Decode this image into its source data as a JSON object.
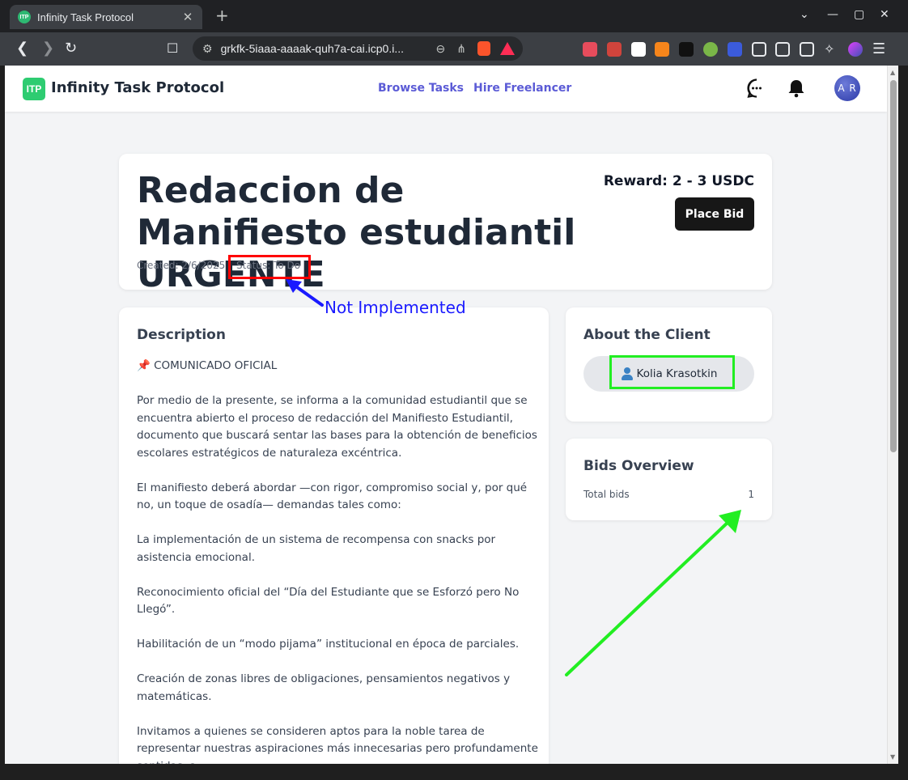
{
  "browser": {
    "tab_title": "Infinity Task Protocol",
    "tab_favicon_text": "ITP",
    "new_tab": "+",
    "url": "grkfk-5iaaa-aaaak-quh7a-cai.icp0.i...",
    "window_controls": [
      "⌄",
      "—",
      "▢",
      "✕"
    ]
  },
  "header": {
    "logo_badge": "ITP",
    "logo_text": "Infinity Task Protocol",
    "nav": [
      "Browse Tasks",
      "Hire Freelancer"
    ],
    "avatar_initials": "A R"
  },
  "task": {
    "title": "Redaccion de Manifiesto estudiantil URGENTE",
    "created": "Created: 2/6/2025",
    "separator": "·",
    "status": "Status: To Do",
    "reward": "Reward: 2 - 3 USDC",
    "bid_button": "Place Bid"
  },
  "description": {
    "heading": "Description",
    "paragraphs": [
      "📌 COMUNICADO OFICIAL",
      "Por medio de la presente, se informa a la comunidad estudiantil que se encuentra abierto el proceso de redacción del Manifiesto Estudiantil, documento que buscará sentar las bases para la obtención de beneficios escolares estratégicos de naturaleza excéntrica.",
      "El manifiesto deberá abordar —con rigor, compromiso social y, por qué no, un toque de osadía— demandas tales como:",
      "La implementación de un sistema de recompensa con snacks por asistencia emocional.",
      "Reconocimiento oficial del “Día del Estudiante que se Esforzó pero No Llegó”.",
      "Habilitación de un “modo pijama” institucional en época de parciales.",
      "Creación de zonas libres de obligaciones, pensamientos negativos y matemáticas.",
      "Invitamos a quienes se consideren aptos para la noble tarea de representar nuestras aspiraciones más innecesarias pero profundamente sentidas, a"
    ]
  },
  "client": {
    "heading": "About the Client",
    "name": "Kolia Krasotkin"
  },
  "bids": {
    "heading": "Bids Overview",
    "total_label": "Total bids",
    "total_value": "1"
  },
  "annotation": {
    "label": "Not Implemented",
    "red": "#ff0000",
    "green": "#22ee22",
    "blue": "#1a1aff"
  }
}
